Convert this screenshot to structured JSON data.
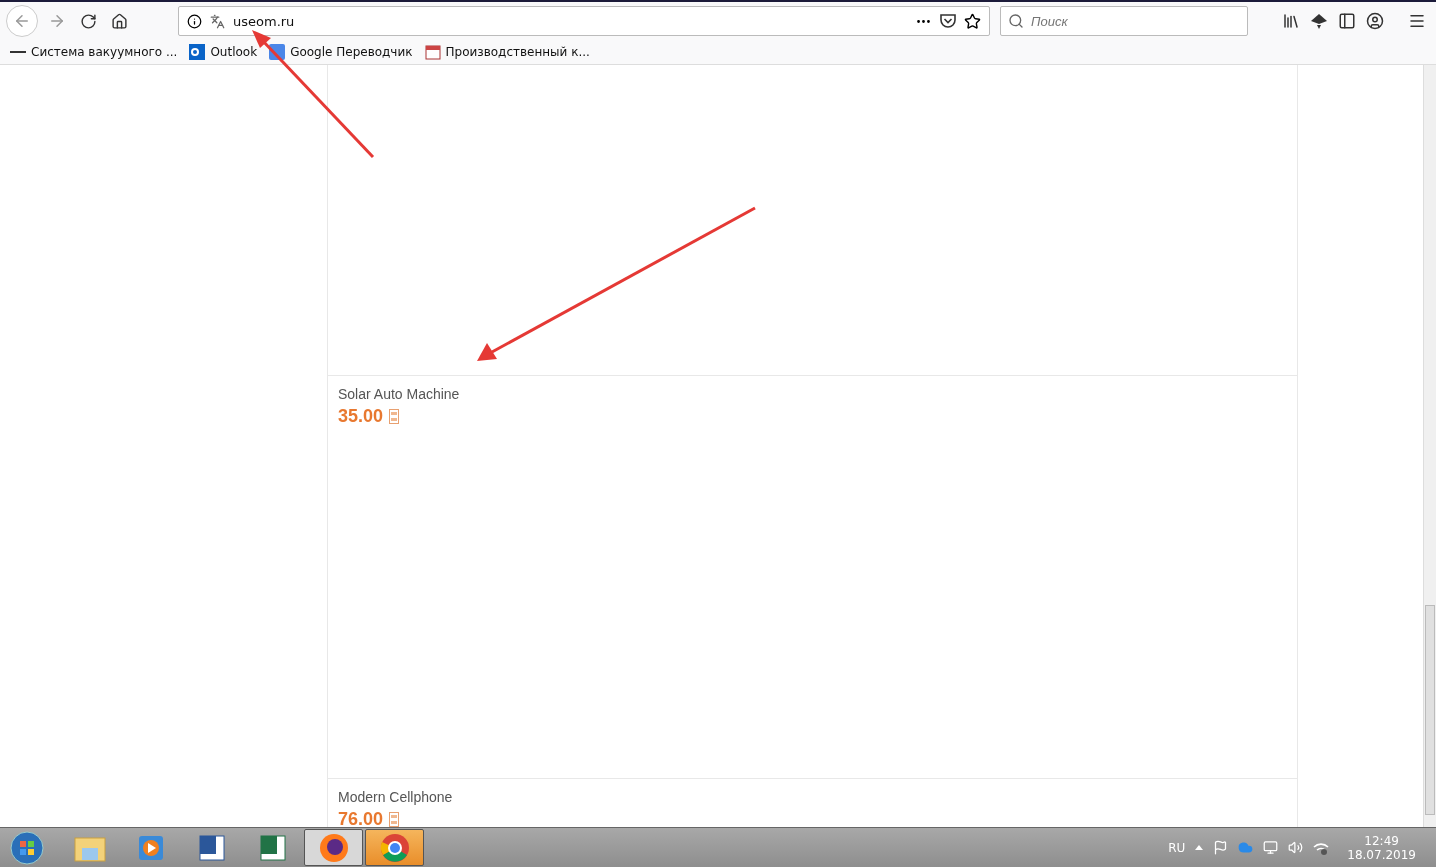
{
  "browser": {
    "address": "useom.ru",
    "search_placeholder": "Поиск"
  },
  "bookmarks": [
    {
      "kind": "site",
      "label": "Система вакуумного ..."
    },
    {
      "kind": "outlook",
      "label": "Outlook"
    },
    {
      "kind": "translate",
      "label": "Google Переводчик"
    },
    {
      "kind": "calendar",
      "label": "Производственный к..."
    }
  ],
  "products": [
    {
      "name": "Solar Auto Machine",
      "price": "35.00"
    },
    {
      "name": "Modern Cellphone",
      "price": "76.00"
    }
  ],
  "taskbar": {
    "apps": [
      {
        "kind": "explorer",
        "selected": false,
        "flashing": false
      },
      {
        "kind": "player",
        "selected": false,
        "flashing": false
      },
      {
        "kind": "word",
        "selected": false,
        "flashing": false
      },
      {
        "kind": "excel",
        "selected": false,
        "flashing": false
      },
      {
        "kind": "firefox",
        "selected": true,
        "flashing": false
      },
      {
        "kind": "chrome",
        "selected": false,
        "flashing": true
      }
    ],
    "language": "RU",
    "time": "12:49",
    "date": "18.07.2019"
  }
}
